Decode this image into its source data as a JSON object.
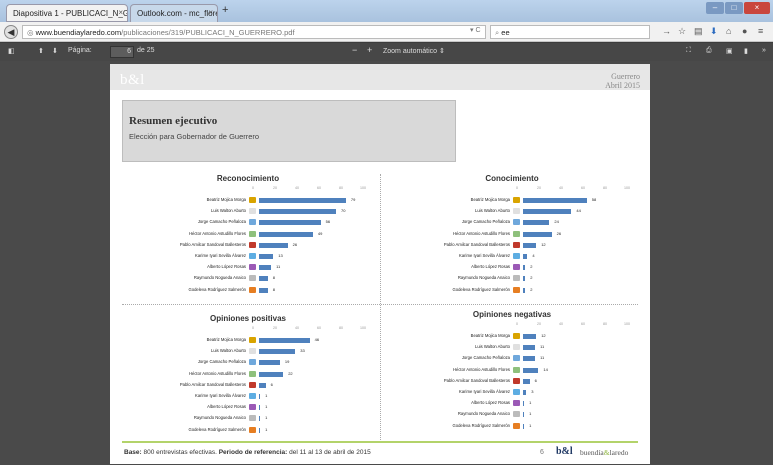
{
  "browser": {
    "tabs": [
      {
        "label": "Diapositiva 1 - PUBLICACI_N_G...",
        "active": true
      },
      {
        "label": "Outlook.com - mc_floresp...",
        "active": false
      }
    ],
    "url_host": "www.buendiaylaredo.com",
    "url_path": "/publicaciones/319/PUBLICACI_N_GUERRERO.pdf",
    "search_value": "ee"
  },
  "pdf_toolbar": {
    "page_label": "Página:",
    "page_current": "6",
    "page_total": "de 25",
    "zoom_label": "Zoom automático"
  },
  "slide": {
    "logo": "b&l",
    "region": "Guerrero",
    "date": "Abril 2015",
    "summary_title": "Resumen ejecutivo",
    "summary_subtitle": "Elección para Gobernador de Guerrero",
    "footer_base_label": "Base:",
    "footer_base_text": " 800 entrevistas efectivas. ",
    "footer_period_label": "Periodo de referencia:",
    "footer_period_text": " del 11 al 13 de abril de 2015",
    "page_number": "6",
    "footer_logo": "b&l",
    "footer_brand_a": "buendía",
    "footer_brand_b": "&",
    "footer_brand_c": "laredo"
  },
  "colors": {
    "bar": "#4f81bd",
    "accent_green": "#b3d36a"
  },
  "chart_data": [
    {
      "type": "bar",
      "title": "Reconocimiento",
      "xlim": [
        0,
        100
      ],
      "ticks": [
        "0",
        "20",
        "40",
        "60",
        "80",
        "100"
      ],
      "categories": [
        "Beatriz Mojica Morga",
        "Luis Walton Aburto",
        "Jorge Camacho Peñaloza",
        "Héctor Antonio Astudillo Flores",
        "Pablo Amilcar Sandoval Ballesteros",
        "Karime Iyari Sevilla Álvarez",
        "Alberto López Rosas",
        "Raymundo Nogueda Anaico",
        "Godeleva Rodríguez Salmerón"
      ],
      "values": [
        79,
        70,
        56,
        49,
        26,
        13,
        11,
        8,
        8
      ]
    },
    {
      "type": "bar",
      "title": "Conocimiento",
      "xlim": [
        0,
        100
      ],
      "ticks": [
        "0",
        "20",
        "40",
        "60",
        "80",
        "100"
      ],
      "categories": [
        "Beatriz Mojica Morga",
        "Luis Walton Aburto",
        "Jorge Camacho Peñaloza",
        "Héctor Antonio Astudillo Flores",
        "Pablo Amilcar Sandoval Ballesteros",
        "Karime Iyari Sevilla Álvarez",
        "Alberto López Rosas",
        "Raymundo Nogueda Anaico",
        "Godeleva Rodríguez Salmerón"
      ],
      "values": [
        58,
        44,
        24,
        26,
        12,
        4,
        2,
        2,
        2
      ]
    },
    {
      "type": "bar",
      "title": "Opiniones positivas",
      "xlim": [
        0,
        100
      ],
      "ticks": [
        "0",
        "20",
        "40",
        "60",
        "80",
        "100"
      ],
      "categories": [
        "Beatriz Mojica Morga",
        "Luis Walton Aburto",
        "Jorge Camacho Peñaloza",
        "Héctor Antonio Astudillo Flores",
        "Pablo Amilcar Sandoval Ballesteros",
        "Karime Iyari Sevilla Álvarez",
        "Alberto López Rosas",
        "Raymundo Nogueda Anaico",
        "Godeleva Rodríguez Salmerón"
      ],
      "values": [
        46,
        33,
        19,
        22,
        6,
        1,
        1,
        1,
        1
      ]
    },
    {
      "type": "bar",
      "title": "Opiniones negativas",
      "xlim": [
        0,
        100
      ],
      "ticks": [
        "0",
        "20",
        "40",
        "60",
        "80",
        "100"
      ],
      "categories": [
        "Beatriz Mojica Morga",
        "Luis Walton Aburto",
        "Jorge Camacho Peñaloza",
        "Héctor Antonio Astudillo Flores",
        "Pablo Amilcar Sandoval Ballesteros",
        "Karime Iyari Sevilla Álvarez",
        "Alberto López Rosas",
        "Raymundo Nogueda Anaico",
        "Godeleva Rodríguez Salmerón"
      ],
      "values": [
        12,
        11,
        11,
        14,
        6,
        3,
        1,
        1,
        1
      ]
    }
  ],
  "party_colors": [
    "#d9a400",
    "#e0e0e0",
    "#6fa8dc",
    "#8ec07c",
    "#c0392b",
    "#5dade2",
    "#9b59b6",
    "#bbbbbb",
    "#e67e22"
  ]
}
